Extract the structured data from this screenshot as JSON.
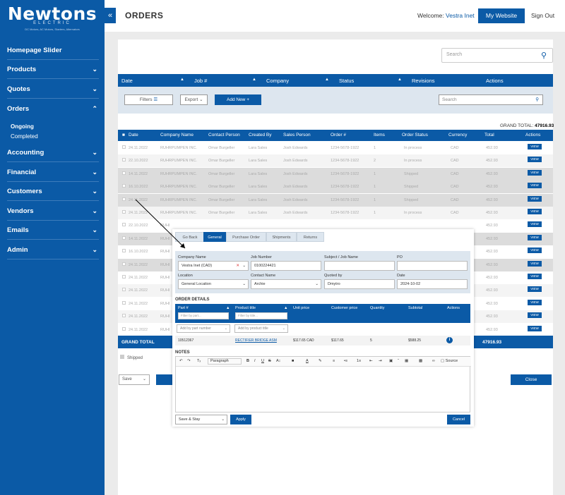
{
  "brand": {
    "name": "Newtons",
    "subtitle": "ELECTRIC",
    "tagline": "DC Motors, AC Motors, Starters, Alternators"
  },
  "header": {
    "title": "ORDERS",
    "welcome_label": "Welcome:",
    "user": "Vestra Inet",
    "my_website": "My Website",
    "sign_out": "Sign Out",
    "collapse_icon": "«"
  },
  "sidebar": {
    "items": [
      {
        "label": "Homepage Slider"
      },
      {
        "label": "Products"
      },
      {
        "label": "Quotes"
      },
      {
        "label": "Orders"
      },
      {
        "label": "Accounting"
      },
      {
        "label": "Financial"
      },
      {
        "label": "Customers"
      },
      {
        "label": "Vendors"
      },
      {
        "label": "Emails"
      },
      {
        "label": "Admin"
      }
    ],
    "sub_items": [
      "Ongoing",
      "Completed"
    ]
  },
  "search": {
    "placeholder": "Search"
  },
  "filter_bar": {
    "columns": [
      "Date",
      "Job #",
      "Company",
      "Status",
      "Revisions",
      "Actions"
    ]
  },
  "toolbar": {
    "filters": "Filters",
    "export": "Export",
    "add_new": "Add New",
    "search_placeholder": "Search"
  },
  "grand_total": {
    "label": "GRAND TOTAL:",
    "value": "47916.93",
    "row_label": "GRAND TOTAL",
    "row_value": "47916.93"
  },
  "table": {
    "headers": [
      "Date",
      "Company Name",
      "Contact Person",
      "Created By",
      "Sales Person",
      "Order #",
      "Items",
      "Order Status",
      "Currency",
      "Total",
      "Actions"
    ],
    "view_label": "VIEW",
    "rows": [
      {
        "date": "24.11.2022",
        "company": "RUHRPUMPEN INC.",
        "contact": "Omar Burgeller",
        "created": "Lara Sales",
        "sales": "Josh Edwards",
        "order": "1234-5678-1922",
        "items": "1",
        "status": "In process",
        "currency": "CAD",
        "total": "452.93"
      },
      {
        "date": "22.10.2022",
        "company": "RUHRPUMPEN INC.",
        "contact": "Omar Burgeller",
        "created": "Lara Sales",
        "sales": "Josh Edwards",
        "order": "1234-5678-1922",
        "items": "2",
        "status": "In process",
        "currency": "CAD",
        "total": "452.93"
      },
      {
        "date": "14.11.2022",
        "company": "RUHRPUMPEN INC.",
        "contact": "Omar Burgeller",
        "created": "Lara Sales",
        "sales": "Josh Edwards",
        "order": "1234-5678-1922",
        "items": "1",
        "status": "Shipped",
        "currency": "CAD",
        "total": "452.93"
      },
      {
        "date": "16.10.2022",
        "company": "RUHRPUMPEN INC.",
        "contact": "Omar Burgeller",
        "created": "Lara Sales",
        "sales": "Josh Edwards",
        "order": "1234-5678-1922",
        "items": "1",
        "status": "Shipped",
        "currency": "CAD",
        "total": "452.93"
      },
      {
        "date": "24.11.2022",
        "company": "RUHRPUMPEN INC.",
        "contact": "Omar Burgeller",
        "created": "Lara Sales",
        "sales": "Josh Edwards",
        "order": "1234-5678-1922",
        "items": "1",
        "status": "Shipped",
        "currency": "CAD",
        "total": "452.93"
      },
      {
        "date": "24.11.2022",
        "company": "RUHRPUMPEN INC.",
        "contact": "Omar Burgeller",
        "created": "Lara Sales",
        "sales": "Josh Edwards",
        "order": "1234-5678-1922",
        "items": "1",
        "status": "In process",
        "currency": "CAD",
        "total": "452.93"
      },
      {
        "date": "22.10.2022",
        "company": "RUHI",
        "contact": "",
        "created": "",
        "sales": "",
        "order": "",
        "items": "",
        "status": "",
        "currency": "",
        "total": "452.93"
      },
      {
        "date": "14.11.2022",
        "company": "RUHI",
        "contact": "",
        "created": "",
        "sales": "",
        "order": "",
        "items": "",
        "status": "",
        "currency": "",
        "total": "452.93"
      },
      {
        "date": "16.10.2022",
        "company": "RUHI",
        "contact": "",
        "created": "",
        "sales": "",
        "order": "",
        "items": "",
        "status": "",
        "currency": "",
        "total": "452.93"
      },
      {
        "date": "24.11.2022",
        "company": "RUHI",
        "contact": "",
        "created": "",
        "sales": "",
        "order": "",
        "items": "",
        "status": "",
        "currency": "",
        "total": "452.93"
      },
      {
        "date": "24.11.2022",
        "company": "RUHI",
        "contact": "",
        "created": "",
        "sales": "",
        "order": "",
        "items": "",
        "status": "",
        "currency": "",
        "total": "452.93"
      },
      {
        "date": "24.11.2022",
        "company": "RUHI",
        "contact": "",
        "created": "",
        "sales": "",
        "order": "",
        "items": "",
        "status": "",
        "currency": "",
        "total": "452.93"
      },
      {
        "date": "24.11.2022",
        "company": "RUHI",
        "contact": "",
        "created": "",
        "sales": "",
        "order": "",
        "items": "",
        "status": "",
        "currency": "",
        "total": "452.93"
      },
      {
        "date": "24.11.2022",
        "company": "RUHI",
        "contact": "",
        "created": "",
        "sales": "",
        "order": "",
        "items": "",
        "status": "",
        "currency": "",
        "total": "452.93"
      },
      {
        "date": "24.11.2022",
        "company": "RUHI",
        "contact": "",
        "created": "",
        "sales": "",
        "order": "",
        "items": "",
        "status": "",
        "currency": "",
        "total": "452.93"
      }
    ]
  },
  "shipped_label": "Shipped",
  "footer": {
    "save": "Save",
    "close": "Close"
  },
  "modal": {
    "tabs": [
      "Go Back",
      "General",
      "Purchase Order",
      "Shipments",
      "Returns"
    ],
    "fields": {
      "company_label": "Company Name",
      "company_value": "Vestra Inet (CAD)",
      "job_label": "Job Number",
      "job_value": "0100224421",
      "subject_label": "Subject / Job Name",
      "subject_value": "",
      "po_label": "PO",
      "po_value": "",
      "location_label": "Location",
      "location_value": "General Location",
      "contact_label": "Contact Name",
      "contact_value": "Archie",
      "quoted_label": "Quoted by",
      "quoted_value": "Dmytro",
      "date_label": "Date",
      "date_value": "2024-10-02"
    },
    "order_details": "ORDER DETAILS",
    "detail_headers": [
      "Part #",
      "Product title",
      "Unit price",
      "Customer price",
      "Quantity",
      "Subtotal",
      "Actions"
    ],
    "filter_part": "Filter by part...",
    "filter_title": "Filter by title...",
    "add_part": "Add by part number",
    "add_title": "Add by product title",
    "detail_row": {
      "part": "10512367",
      "title": "RECTIFIER BRIDGE ASM",
      "unit": "$117.65 CAD",
      "customer": "$117.65",
      "qty": "5",
      "subtotal": "$588.25"
    },
    "notes": "NOTES",
    "editor": {
      "paragraph": "Paragraph",
      "source": "Source"
    },
    "save_stay": "Save & Stay",
    "apply": "Apply",
    "cancel": "Cancel"
  }
}
